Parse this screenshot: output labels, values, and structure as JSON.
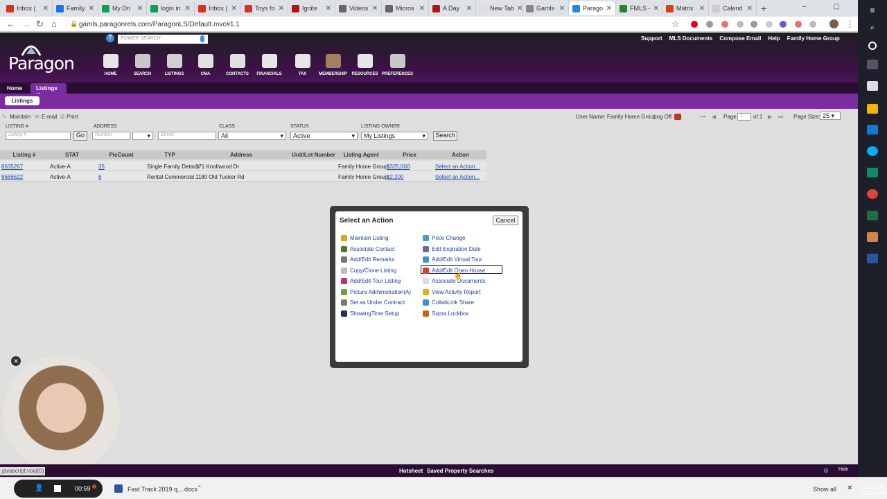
{
  "browser": {
    "tabs": [
      {
        "label": "Inbox (",
        "color": "#d93025"
      },
      {
        "label": "Family",
        "color": "#1a73e8"
      },
      {
        "label": "My Dri",
        "color": "#0f9d58"
      },
      {
        "label": "login in",
        "color": "#0f9d58"
      },
      {
        "label": "Inbox (",
        "color": "#d93025"
      },
      {
        "label": "Toys fo",
        "color": "#d93025"
      },
      {
        "label": "Ignite",
        "color": "#b31412"
      },
      {
        "label": "Videos",
        "color": "#666666"
      },
      {
        "label": "Micros",
        "color": "#666666"
      },
      {
        "label": "A Day",
        "color": "#b31412"
      },
      {
        "label": "New Tab",
        "color": "#dddddd"
      },
      {
        "label": "Gamls",
        "color": "#888888"
      },
      {
        "label": "Parago",
        "color": "#1e88e5"
      },
      {
        "label": "FMLS -",
        "color": "#2e7d32"
      },
      {
        "label": "Matrix",
        "color": "#d84315"
      },
      {
        "label": "Calend",
        "color": "#cccccc"
      }
    ],
    "url": "gamls.paragonrels.com/ParagonLS/Default.mvc#1.1"
  },
  "header": {
    "logo": "Paragon",
    "power_search_placeholder": "POWER SEARCH",
    "nav": [
      "HOME",
      "SEARCH",
      "LISTINGS",
      "CMA",
      "CONTACTS",
      "FINANCIALS",
      "TAX",
      "MEMBERSHIP",
      "RESOURCES",
      "PREFERENCES"
    ],
    "top_links": [
      "Support",
      "MLS Documents",
      "Compose Email",
      "Help",
      "Family Home Group"
    ]
  },
  "tabs": {
    "home": "Home",
    "listings": "Listings",
    "close": "✕",
    "sub": "Listings"
  },
  "toolbar": {
    "maintain": "Maintain",
    "email": "E-mail",
    "print": "Print",
    "user": "User Name: Family Home Group",
    "logoff": "Log Off",
    "page_label": "Page",
    "page_value": "1",
    "of": "of 1",
    "page_size_label": "Page Size:",
    "page_size": "25"
  },
  "filters": {
    "listing_label": "LISTING #",
    "listing_placeholder": "Listing #",
    "go": "Go",
    "address_label": "ADDRESS",
    "number_placeholder": "Number",
    "street_placeholder": "Street",
    "class_label": "CLASS",
    "class_value": "All",
    "status_label": "STATUS",
    "status_value": "Active",
    "owner_label": "LISTING OWNER",
    "owner_value": "My Listings",
    "search": "Search"
  },
  "table": {
    "headers": [
      "Listing #",
      "STAT",
      "PicCount",
      "TYP",
      "Address",
      "Unit/Lot Number",
      "Listing Agent",
      "Price",
      "Action"
    ],
    "rows": [
      {
        "listing": "8635267",
        "stat": "Active-A",
        "pics": "35",
        "type": "Single Family Detach",
        "address": "171 Knollwood Dr",
        "unit": "",
        "agent": "Family Home Group",
        "price": "$325,000",
        "action": "Select an Action..."
      },
      {
        "listing": "8686622",
        "stat": "Active-A",
        "pics": "6",
        "type": "Rental Commercial",
        "address": "1180 Old Tucker Rd",
        "unit": "",
        "agent": "Family Home Group",
        "price": "$2,200",
        "action": "Select an Action..."
      }
    ]
  },
  "dialog": {
    "title": "Select an Action",
    "cancel": "Cancel",
    "left": [
      "Maintain Listing",
      "Associate Contact",
      "Add/Edit Remarks",
      "Copy/Clone Listing",
      "Add/Edit Tour Listing",
      "Picture Administration(A)",
      "Set as Under Contract",
      "ShowingTime Setup"
    ],
    "right": [
      "Price Change",
      "Edit Expiration Date",
      "Add/Edit Virtual Tour",
      "Add/Edit Open House",
      "Associate Documents",
      "View Activity Report",
      "CollabLink Share",
      "Supra Lockbox"
    ],
    "left_colors": [
      "#e0a020",
      "#4a7a30",
      "#777777",
      "#bbbbbb",
      "#c0307a",
      "#6aa040",
      "#777777",
      "#203060"
    ],
    "right_colors": [
      "#4aa0c0",
      "#6a6a9a",
      "#4a90c0",
      "#d04030",
      "#dddddd",
      "#e0b020",
      "#3a90d0",
      "#d06010"
    ]
  },
  "bottom": {
    "status_link": "javascript:void(0)",
    "hotsheet": "Hotsheet",
    "saved": "Saved Property Searches",
    "hide": "Hide"
  },
  "taskbar": {
    "timer": "00:59",
    "file": "Fast Track 2019 q....docx",
    "show_all": "Show all",
    "time": "11:03 AM",
    "date": "11/19/2019"
  }
}
